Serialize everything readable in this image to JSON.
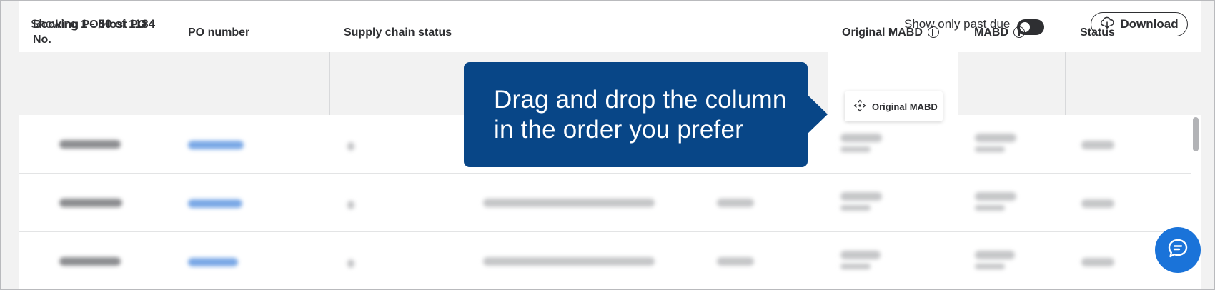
{
  "toolbar": {
    "showing_prefix": "Showing",
    "range_start": "1",
    "range_sep": "-",
    "range_end": "50",
    "of_word": "of",
    "total": "1184",
    "past_due_label": "Show only past due",
    "past_due_enabled": true,
    "download_label": "Download"
  },
  "table": {
    "columns": [
      {
        "label": "Booking PO/Host PO No."
      },
      {
        "label": "PO number"
      },
      {
        "label": "Supply chain status"
      },
      {
        "label": "Original MABD"
      },
      {
        "label": "MABD"
      },
      {
        "label": "Status"
      }
    ],
    "rows": 3
  },
  "drag": {
    "chip_label": "Original MABD",
    "tooltip_line1": "Drag and drop the column",
    "tooltip_line2": "in the order you prefer"
  },
  "colors": {
    "tooltip_bg": "#084687",
    "chat_bg": "#1a73d9",
    "header_bg": "#f2f2f2"
  },
  "icons": [
    "cloud-download-icon",
    "info-icon",
    "drag-move-icon",
    "chat-icon"
  ]
}
